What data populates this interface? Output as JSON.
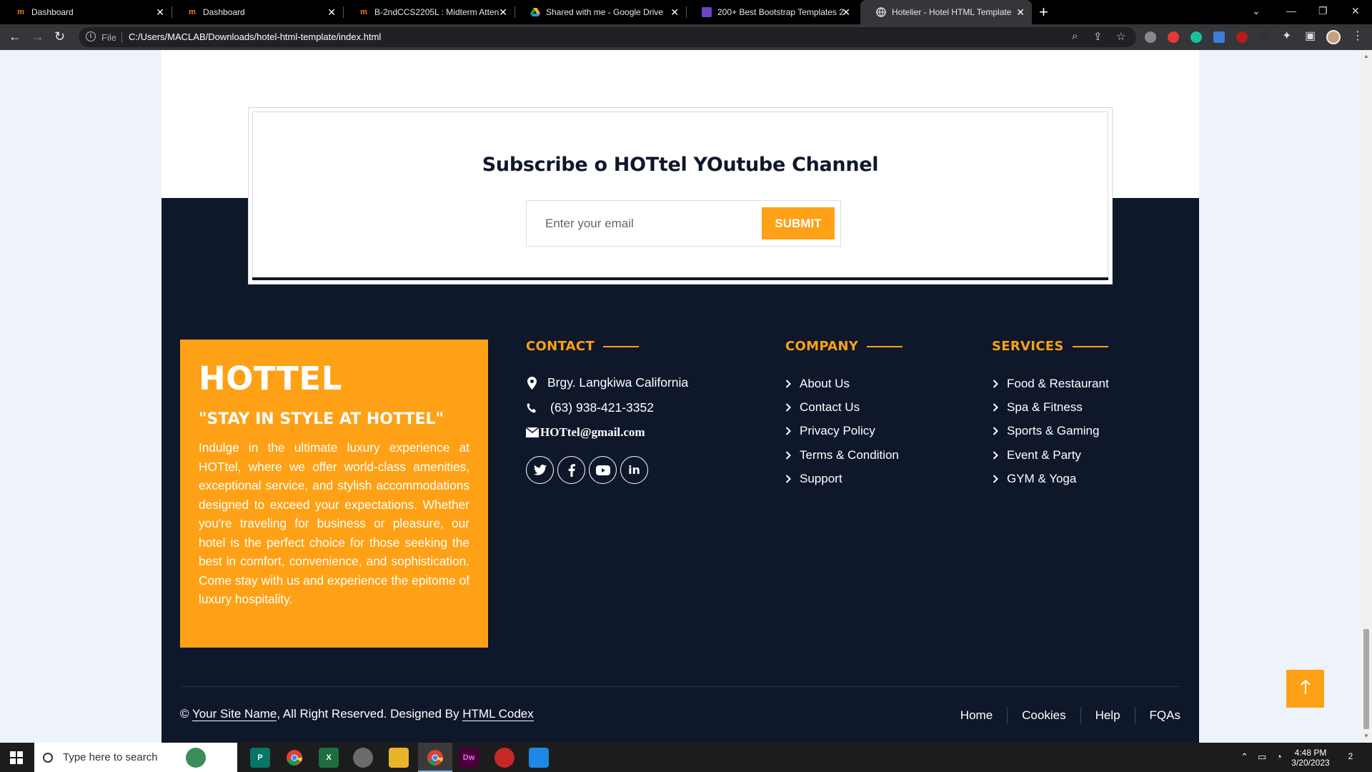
{
  "browser": {
    "tabs": [
      {
        "label": "Dashboard",
        "favicon": "moodle-icon"
      },
      {
        "label": "Dashboard",
        "favicon": "moodle-icon"
      },
      {
        "label": "B-2ndCCS2205L : Midterm Atten",
        "favicon": "moodle-icon"
      },
      {
        "label": "Shared with me - Google Drive",
        "favicon": "google-drive-icon"
      },
      {
        "label": "200+ Best Bootstrap Templates 2",
        "favicon": "themewagon-icon"
      },
      {
        "label": "Hotelier - Hotel HTML Template",
        "favicon": "globe-icon"
      }
    ],
    "active_tab_index": 5,
    "address": {
      "scheme_label": "File",
      "url": "C:/Users/MACLAB/Downloads/hotel-html-template/index.html"
    }
  },
  "newsletter": {
    "title": "Subscribe o HOTtel YOutube Channel",
    "email_placeholder": "Enter your email",
    "submit_label": "SUBMIT"
  },
  "brand": {
    "name": "HOTTEL",
    "tagline": "\"STAY IN STYLE AT HOTTEL\"",
    "description": "Indulge in the ultimate luxury experience at HOTtel, where we offer world-class amenities, exceptional service, and stylish accommodations designed to exceed your expectations. Whether you're traveling for business or pleasure, our hotel is the perfect choice for those seeking the best in comfort, convenience, and sophistication. Come stay with us and experience the epitome of luxury hospitality."
  },
  "contact": {
    "title": "CONTACT",
    "address": "Brgy. Langkiwa California",
    "phone": "(63) 938-421-3352",
    "email": "HOTtel@gmail.com",
    "social": [
      "twitter-icon",
      "facebook-icon",
      "youtube-icon",
      "linkedin-icon"
    ]
  },
  "company": {
    "title": "COMPANY",
    "links": [
      "About Us",
      "Contact Us",
      "Privacy Policy",
      "Terms & Condition",
      "Support"
    ]
  },
  "services": {
    "title": "SERVICES",
    "links": [
      "Food & Restaurant",
      "Spa & Fitness",
      "Sports & Gaming",
      "Event & Party",
      "GYM & Yoga"
    ]
  },
  "footer": {
    "copyright_prefix": "©",
    "site_name": "Your Site Name",
    "rights_text": ", All Right Reserved. Designed By",
    "designer": "HTML Codex",
    "menu": [
      "Home",
      "Cookies",
      "Help",
      "FQAs"
    ]
  },
  "taskbar": {
    "search_placeholder": "Type here to search",
    "time": "4:48 PM",
    "date": "3/20/2023",
    "notification_count": "2"
  },
  "colors": {
    "accent": "#fea116",
    "dark": "#0f172b"
  }
}
